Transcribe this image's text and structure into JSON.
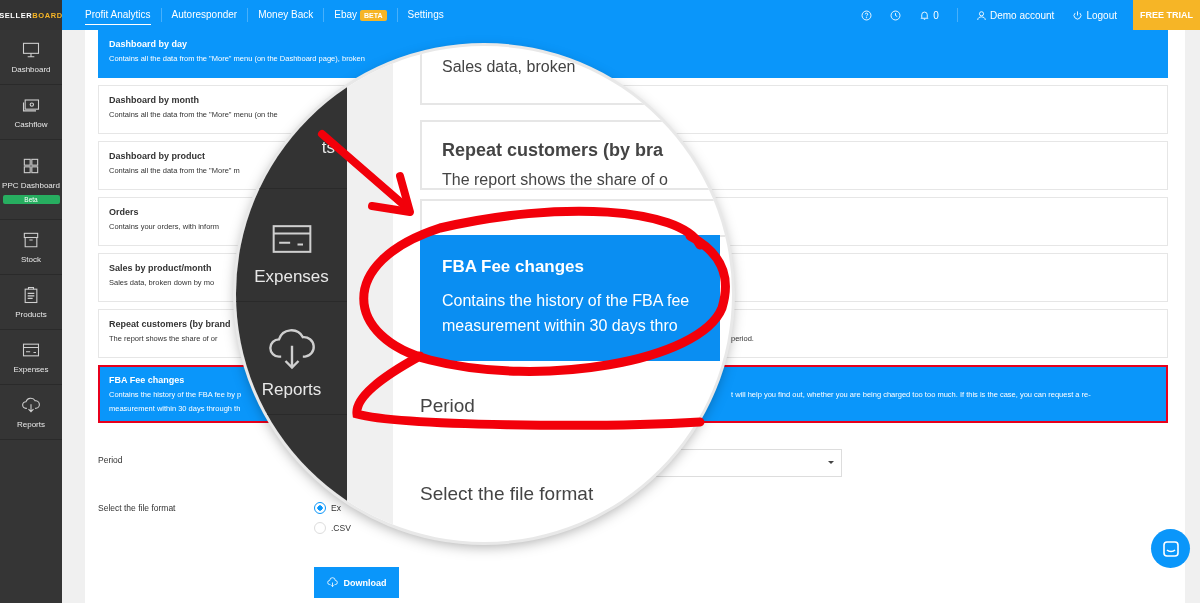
{
  "logo": [
    "SELLER",
    "BOARD"
  ],
  "nav": [
    {
      "label": "Profit Analytics",
      "selected": true
    },
    {
      "label": "Autoresponder",
      "selected": false
    },
    {
      "label": "Money Back",
      "selected": false
    },
    {
      "label": "Ebay",
      "selected": false,
      "badge": "BETA"
    },
    {
      "label": "Settings",
      "selected": false
    }
  ],
  "notifications": {
    "count": "0"
  },
  "account": {
    "user": "Demo account",
    "logout": "Logout",
    "trial": "FREE TRIAL"
  },
  "sidebar": [
    {
      "label": "Dashboard"
    },
    {
      "label": "Cashflow"
    },
    {
      "label": "PPC Dashboard",
      "badge": "Beta"
    },
    {
      "label": "Stock"
    },
    {
      "label": "Products"
    },
    {
      "label": "Expenses"
    },
    {
      "label": "Reports"
    }
  ],
  "reports": [
    {
      "title": "Dashboard by day",
      "lines": [
        [
          "Contains all the data from the \"More\" menu (on the Dashboard page), broken"
        ]
      ],
      "selected": true,
      "outlined": false
    },
    {
      "title": "Dashboard by month",
      "lines": [
        [
          "Contains all the data from the \"More\" menu (on the"
        ]
      ],
      "selected": false,
      "outlined": false
    },
    {
      "title": "Dashboard by product",
      "lines": [
        [
          "Contains all the data from the \"More\" m"
        ]
      ],
      "selected": false,
      "outlined": false
    },
    {
      "title": "Orders",
      "lines": [
        [
          "Contains your orders, with inform"
        ]
      ],
      "selected": false,
      "outlined": false
    },
    {
      "title": "Sales by product/month",
      "lines": [
        [
          "Sales data, broken down by mo"
        ]
      ],
      "selected": false,
      "outlined": false
    },
    {
      "title": "Repeat customers (by brand",
      "lines": [
        [
          "The report shows the share of or",
          "period."
        ]
      ],
      "selected": false,
      "outlined": false
    },
    {
      "title": "FBA Fee changes",
      "lines": [
        [
          "Contains the history of the FBA fee by p",
          "t will help you find out, whether you are being charged too too much. If this is the case, you can request a re-"
        ],
        [
          "measurement within 30 days through th"
        ]
      ],
      "selected": true,
      "outlined": true
    }
  ],
  "form": {
    "period_label": "Period",
    "format_label": "Select the file format",
    "formats": [
      {
        "label": "Ex",
        "selected": true
      },
      {
        "label": ".CSV",
        "selected": false
      }
    ],
    "download": "Download"
  },
  "magnifier": {
    "sidebar": [
      {
        "label": "ts"
      },
      {
        "label": "Expenses"
      },
      {
        "label": "Reports"
      }
    ],
    "cards": [
      {
        "text": "Sales data, broken"
      },
      {
        "title": "Repeat customers (by bra",
        "text": "The report shows the share of o"
      }
    ],
    "highlight": {
      "title": "FBA Fee changes",
      "lines": [
        "Contains the history of the FBA fee",
        "measurement within 30 days thro"
      ]
    },
    "period_label": "Period",
    "format_label": "Select the file format"
  }
}
